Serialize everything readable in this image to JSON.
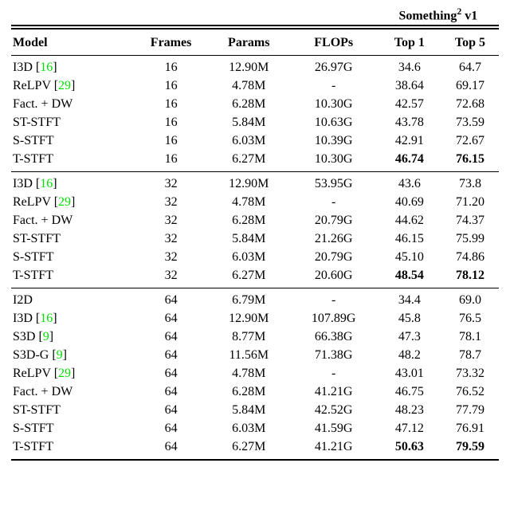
{
  "chart_data": {
    "type": "table",
    "title_group": "Something² v1",
    "columns": [
      "Model",
      "Frames",
      "Params",
      "FLOPs",
      "Top 1",
      "Top 5"
    ],
    "sections": [
      {
        "rows": [
          {
            "model": "I3D",
            "ref": "[16]",
            "frames": "16",
            "params": "12.90M",
            "flops": "26.97G",
            "top1": "34.6",
            "top5": "64.7",
            "bold": false
          },
          {
            "model": "ReLPV",
            "ref": "[29]",
            "frames": "16",
            "params": "4.78M",
            "flops": "-",
            "top1": "38.64",
            "top5": "69.17",
            "bold": false
          },
          {
            "model": "Fact. + DW",
            "ref": "",
            "frames": "16",
            "params": "6.28M",
            "flops": "10.30G",
            "top1": "42.57",
            "top5": "72.68",
            "bold": false
          },
          {
            "model": "ST-STFT",
            "ref": "",
            "frames": "16",
            "params": "5.84M",
            "flops": "10.63G",
            "top1": "43.78",
            "top5": "73.59",
            "bold": false
          },
          {
            "model": "S-STFT",
            "ref": "",
            "frames": "16",
            "params": "6.03M",
            "flops": "10.39G",
            "top1": "42.91",
            "top5": "72.67",
            "bold": false
          },
          {
            "model": "T-STFT",
            "ref": "",
            "frames": "16",
            "params": "6.27M",
            "flops": "10.30G",
            "top1": "46.74",
            "top5": "76.15",
            "bold": true
          }
        ]
      },
      {
        "rows": [
          {
            "model": "I3D",
            "ref": "[16]",
            "frames": "32",
            "params": "12.90M",
            "flops": "53.95G",
            "top1": "43.6",
            "top5": "73.8",
            "bold": false
          },
          {
            "model": "ReLPV",
            "ref": "[29]",
            "frames": "32",
            "params": "4.78M",
            "flops": "-",
            "top1": "40.69",
            "top5": "71.20",
            "bold": false
          },
          {
            "model": "Fact. + DW",
            "ref": "",
            "frames": "32",
            "params": "6.28M",
            "flops": "20.79G",
            "top1": "44.62",
            "top5": "74.37",
            "bold": false
          },
          {
            "model": "ST-STFT",
            "ref": "",
            "frames": "32",
            "params": "5.84M",
            "flops": "21.26G",
            "top1": "46.15",
            "top5": "75.99",
            "bold": false
          },
          {
            "model": "S-STFT",
            "ref": "",
            "frames": "32",
            "params": "6.03M",
            "flops": "20.79G",
            "top1": "45.10",
            "top5": "74.86",
            "bold": false
          },
          {
            "model": "T-STFT",
            "ref": "",
            "frames": "32",
            "params": "6.27M",
            "flops": "20.60G",
            "top1": "48.54",
            "top5": "78.12",
            "bold": true
          }
        ]
      },
      {
        "rows": [
          {
            "model": "I2D",
            "ref": "",
            "frames": "64",
            "params": "6.79M",
            "flops": "-",
            "top1": "34.4",
            "top5": "69.0",
            "bold": false
          },
          {
            "model": "I3D",
            "ref": "[16]",
            "frames": "64",
            "params": "12.90M",
            "flops": "107.89G",
            "top1": "45.8",
            "top5": "76.5",
            "bold": false
          },
          {
            "model": "S3D",
            "ref": "[9]",
            "frames": "64",
            "params": "8.77M",
            "flops": "66.38G",
            "top1": "47.3",
            "top5": "78.1",
            "bold": false
          },
          {
            "model": "S3D-G",
            "ref": "[9]",
            "frames": "64",
            "params": "11.56M",
            "flops": "71.38G",
            "top1": "48.2",
            "top5": "78.7",
            "bold": false
          },
          {
            "model": "ReLPV",
            "ref": "[29]",
            "frames": "64",
            "params": "4.78M",
            "flops": "-",
            "top1": "43.01",
            "top5": "73.32",
            "bold": false
          },
          {
            "model": "Fact. + DW",
            "ref": "",
            "frames": "64",
            "params": "6.28M",
            "flops": "41.21G",
            "top1": "46.75",
            "top5": "76.52",
            "bold": false
          },
          {
            "model": "ST-STFT",
            "ref": "",
            "frames": "64",
            "params": "5.84M",
            "flops": "42.52G",
            "top1": "48.23",
            "top5": "77.79",
            "bold": false
          },
          {
            "model": "S-STFT",
            "ref": "",
            "frames": "64",
            "params": "6.03M",
            "flops": "41.59G",
            "top1": "47.12",
            "top5": "76.91",
            "bold": false
          },
          {
            "model": "T-STFT",
            "ref": "",
            "frames": "64",
            "params": "6.27M",
            "flops": "41.21G",
            "top1": "50.63",
            "top5": "79.59",
            "bold": true
          }
        ]
      }
    ]
  },
  "labels": {
    "group_a": "Something",
    "group_b": "v1",
    "model": "Model",
    "frames": "Frames",
    "params": "Params",
    "flops": "FLOPs",
    "top1": "Top 1",
    "top5": "Top 5"
  }
}
